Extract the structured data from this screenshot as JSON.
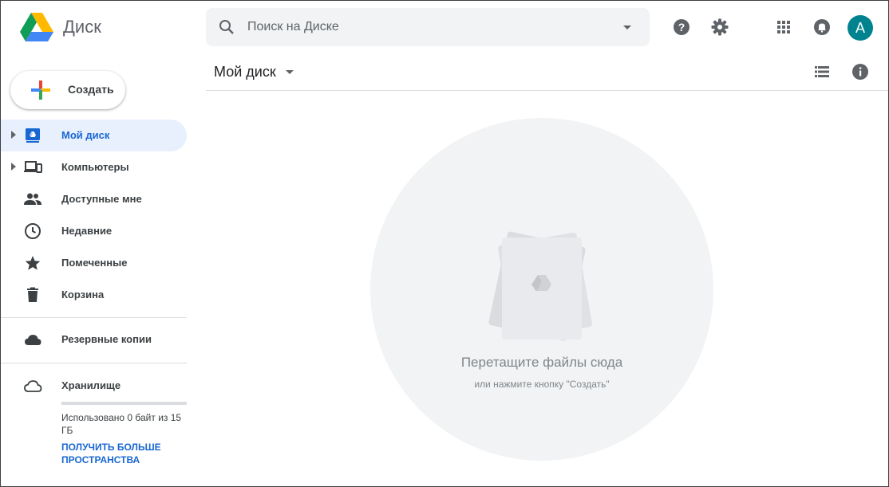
{
  "app": {
    "name": "Диск"
  },
  "search": {
    "placeholder": "Поиск на Диске"
  },
  "header": {
    "avatar_letter": "A"
  },
  "new_button": {
    "label": "Создать"
  },
  "sidebar": {
    "items": [
      {
        "label": "Мой диск",
        "icon": "my-drive-icon",
        "active": true,
        "expandable": true
      },
      {
        "label": "Компьютеры",
        "icon": "computers-icon",
        "active": false,
        "expandable": true
      },
      {
        "label": "Доступные мне",
        "icon": "shared-people-icon",
        "active": false,
        "expandable": false
      },
      {
        "label": "Недавние",
        "icon": "clock-icon",
        "active": false,
        "expandable": false
      },
      {
        "label": "Помеченные",
        "icon": "star-icon",
        "active": false,
        "expandable": false
      },
      {
        "label": "Корзина",
        "icon": "trash-icon",
        "active": false,
        "expandable": false
      }
    ],
    "backups": {
      "label": "Резервные копии",
      "icon": "cloud-filled-icon"
    },
    "storage": {
      "label": "Хранилище",
      "icon": "cloud-outline-icon",
      "used_text": "Использовано 0 байт из 15 ГБ",
      "used_fraction": 0,
      "upgrade_link": "ПОЛУЧИТЬ БОЛЬШЕ ПРОСТРАНСТВА"
    }
  },
  "main": {
    "title": "Мой диск",
    "empty_title": "Перетащите файлы сюда",
    "empty_subtitle": "или нажмите кнопку \"Создать\""
  },
  "colors": {
    "accent": "#1967d2",
    "active_bg": "#e8f0fe",
    "avatar_bg": "#00838f",
    "icon_gray": "#5f6368",
    "drop_circle": "#f1f3f4"
  }
}
